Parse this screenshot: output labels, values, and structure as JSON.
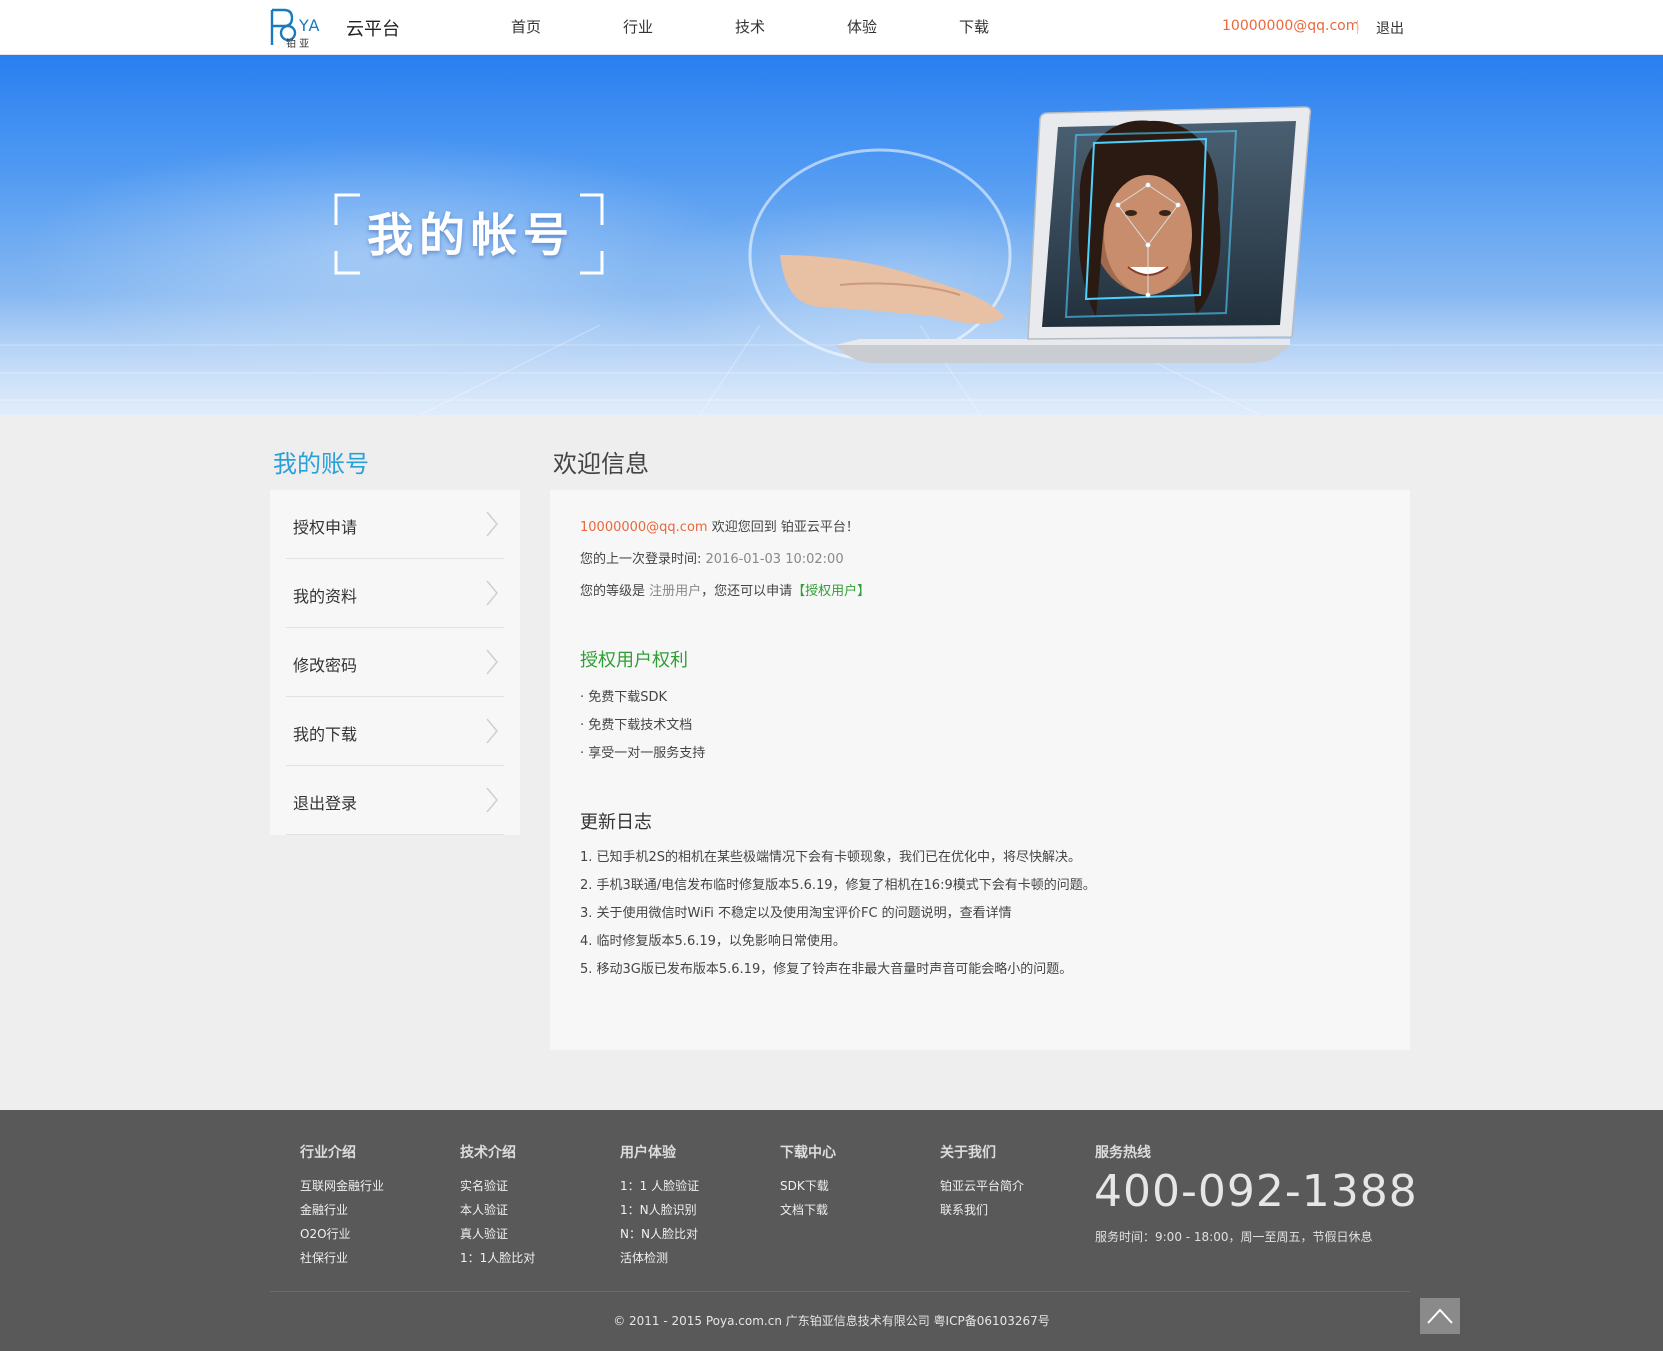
{
  "header": {
    "logo_text": "POYA",
    "logo_sub": "铂 亚",
    "platform": "云平台",
    "nav": [
      "首页",
      "行业",
      "技术",
      "体验",
      "下载"
    ],
    "user_email": "10000000@qq.com",
    "logout": "退出"
  },
  "banner": {
    "title": "我的帐号"
  },
  "sidebar": {
    "title": "我的账号",
    "items": [
      "授权申请",
      "我的资料",
      "修改密码",
      "我的下载",
      "退出登录"
    ]
  },
  "main": {
    "title": "欢迎信息",
    "welcome_email": "10000000@qq.com",
    "welcome_text": " 欢迎您回到 铂亚云平台！",
    "last_login_label": "您的上一次登录时间: ",
    "last_login_value": "2016-01-03 10:02:00",
    "level_label": "您的等级是 ",
    "level_value": "注册用户",
    "level_mid": "，您还可以申请",
    "level_apply": "【授权用户】",
    "rights_title": "授权用户权利",
    "rights": [
      "· 免费下载SDK",
      "· 免费下载技术文档",
      "· 享受一对一服务支持"
    ],
    "log_title": "更新日志",
    "logs": [
      "1. 已知手机2S的相机在某些极端情况下会有卡顿现象，我们已在优化中，将尽快解决。",
      "2. 手机3联通/电信发布临时修复版本5.6.19，修复了相机在16:9模式下会有卡顿的问题。",
      "3. 关于使用微信时WiFi 不稳定以及使用淘宝评价FC 的问题说明，查看详情",
      "4. 临时修复版本5.6.19，以免影响日常使用。",
      "5. 移动3G版已发布版本5.6.19，修复了铃声在非最大音量时声音可能会略小的问题。"
    ]
  },
  "footer": {
    "cols": [
      {
        "title": "行业介绍",
        "items": [
          "互联网金融行业",
          "金融行业",
          "O2O行业",
          "社保行业"
        ]
      },
      {
        "title": "技术介绍",
        "items": [
          "实名验证",
          "本人验证",
          "真人验证",
          "1：1人脸比对"
        ]
      },
      {
        "title": "用户体验",
        "items": [
          "1：1 人脸验证",
          "1：N人脸识别",
          "N：N人脸比对",
          "活体检测"
        ]
      },
      {
        "title": "下载中心",
        "items": [
          "SDK下载",
          "文档下载"
        ]
      },
      {
        "title": "关于我们",
        "items": [
          "铂亚云平台简介",
          "联系我们"
        ]
      }
    ],
    "hotline_title": "服务热线",
    "hotline": "400-092-1388",
    "hours": "服务时间：9:00 - 18:00，周一至周五，节假日休息",
    "copyright": "© 2011 - 2015 Poya.com.cn 广东铂亚信息技术有限公司 粤ICP备06103267号"
  },
  "colors": {
    "accent_orange": "#e8693d",
    "accent_blue": "#2aa0d8",
    "accent_green": "#2f9f35",
    "footer_bg": "#595959"
  }
}
